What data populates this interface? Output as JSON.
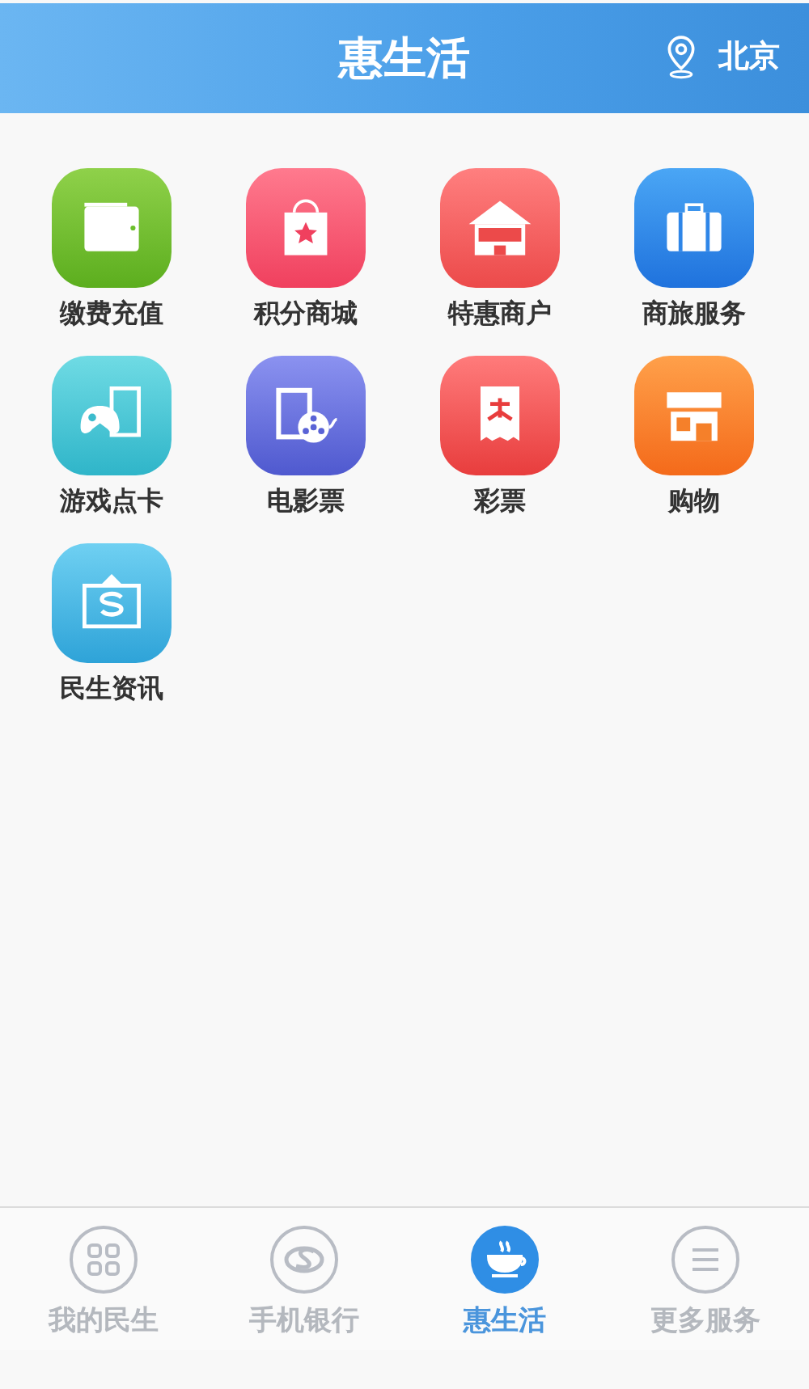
{
  "header": {
    "title": "惠生活",
    "location": "北京"
  },
  "services": [
    {
      "label": "缴费充值"
    },
    {
      "label": "积分商城"
    },
    {
      "label": "特惠商户"
    },
    {
      "label": "商旅服务"
    },
    {
      "label": "游戏点卡"
    },
    {
      "label": "电影票"
    },
    {
      "label": "彩票"
    },
    {
      "label": "购物"
    },
    {
      "label": "民生资讯"
    }
  ],
  "tabs": [
    {
      "label": "我的民生",
      "selected": false
    },
    {
      "label": "手机银行",
      "selected": false
    },
    {
      "label": "惠生活",
      "selected": true
    },
    {
      "label": "更多服务",
      "selected": false
    }
  ]
}
